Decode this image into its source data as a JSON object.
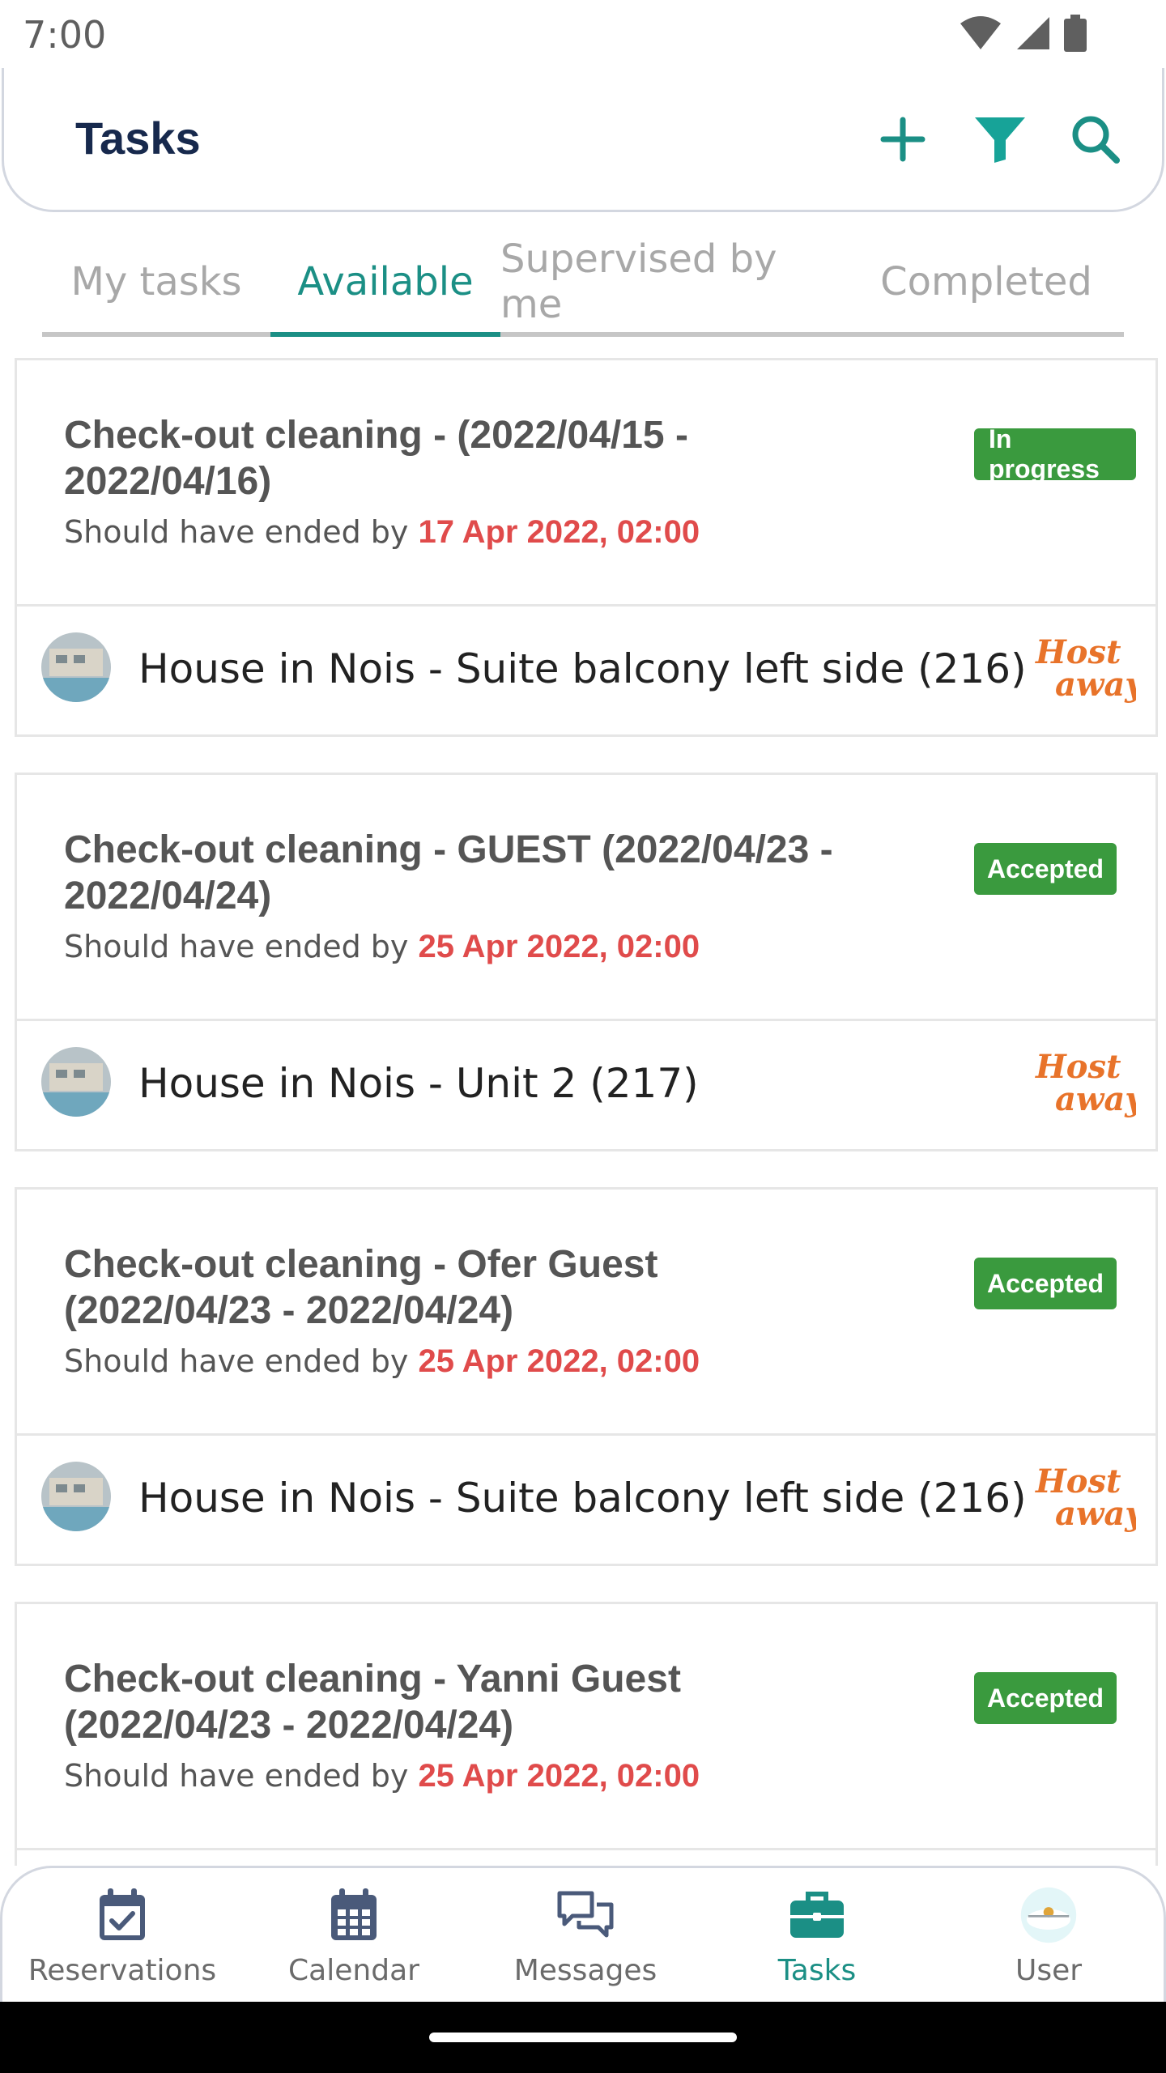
{
  "status_bar": {
    "time": "7:00"
  },
  "header": {
    "title": "Tasks"
  },
  "tabs": [
    {
      "label": "My tasks",
      "active": false
    },
    {
      "label": "Available",
      "active": true
    },
    {
      "label": "Supervised by me",
      "active": false
    },
    {
      "label": "Completed",
      "active": false
    }
  ],
  "tasks": [
    {
      "title": "Check-out cleaning - (2022/04/15 - 2022/04/16)",
      "deadline_prefix": "Should have ended by ",
      "deadline_date": "17 Apr 2022, 02:00",
      "status": "In progress",
      "property": "House in Nois - Suite balcony left side (216)",
      "source": "Hostaway"
    },
    {
      "title": "Check-out cleaning - GUEST (2022/04/23 - 2022/04/24)",
      "deadline_prefix": "Should have ended by ",
      "deadline_date": "25 Apr 2022, 02:00",
      "status": "Accepted",
      "property": "House in Nois - Unit 2 (217)",
      "source": "Hostaway"
    },
    {
      "title": "Check-out cleaning - Ofer Guest (2022/04/23 - 2022/04/24)",
      "deadline_prefix": "Should have ended by ",
      "deadline_date": "25 Apr 2022, 02:00",
      "status": "Accepted",
      "property": "House in Nois - Suite balcony left side (216)",
      "source": "Hostaway"
    },
    {
      "title": "Check-out cleaning - Yanni Guest (2022/04/23 - 2022/04/24)",
      "deadline_prefix": "Should have ended by ",
      "deadline_date": "25 Apr 2022, 02:00",
      "status": "Accepted",
      "property": "",
      "source": ""
    }
  ],
  "bottom_nav": [
    {
      "label": "Reservations",
      "icon": "calendar-check-icon"
    },
    {
      "label": "Calendar",
      "icon": "calendar-icon"
    },
    {
      "label": "Messages",
      "icon": "messages-icon"
    },
    {
      "label": "Tasks",
      "icon": "briefcase-icon",
      "active": true
    },
    {
      "label": "User",
      "icon": "user-avatar"
    }
  ],
  "colors": {
    "accent": "#1b8f85",
    "title": "#17294d",
    "status_green": "#3a9a3e",
    "deadline_red": "#e04b4b"
  }
}
